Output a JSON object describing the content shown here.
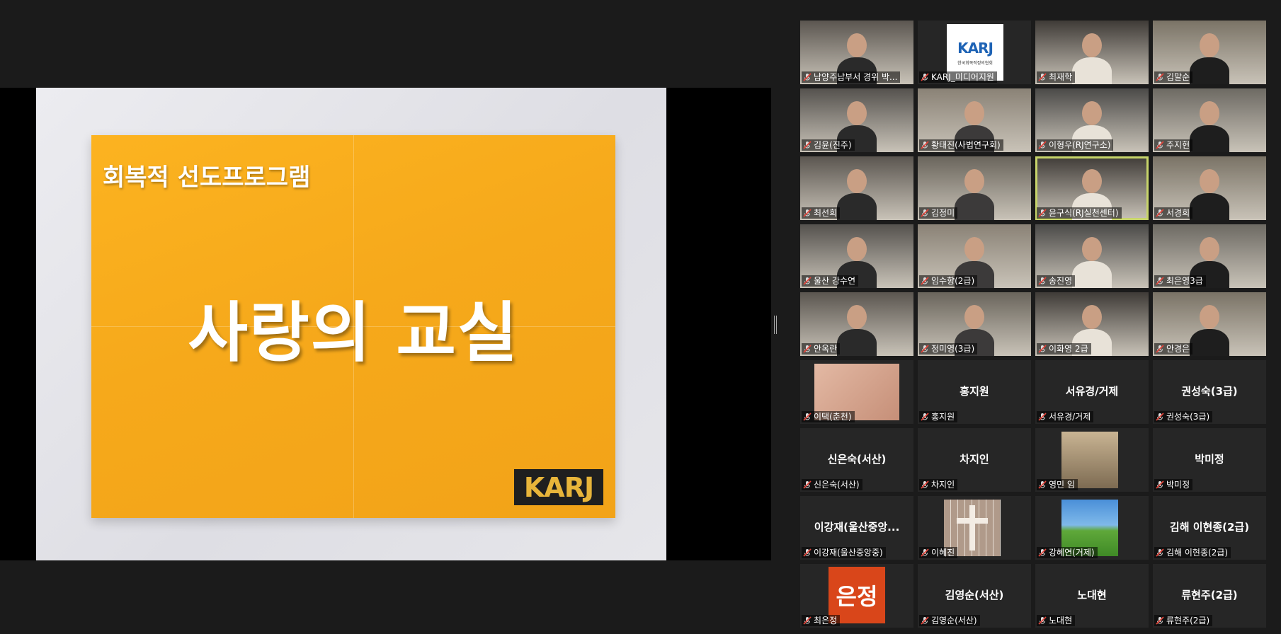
{
  "share": {
    "subtitle": "회복적 선도프로그램",
    "title": "사랑의 교실",
    "logo_text": "KARJ"
  },
  "colors": {
    "background": "#1b1b1b",
    "poster_orange": "#f6a91b",
    "active_speaker": "#c7d46a",
    "muted_mic": "#e0443a"
  },
  "participants": [
    {
      "label": "남양주남부서 경위 박...",
      "center_name": "",
      "video": true
    },
    {
      "label": "KARJ_미디어지원",
      "center_name": "",
      "video": true,
      "logo_text": "KARJ",
      "logo_caption": "한국회복적정의협회"
    },
    {
      "label": "최재학",
      "center_name": "",
      "video": true
    },
    {
      "label": "김말순",
      "center_name": "",
      "video": true
    },
    {
      "label": "김윤(진주)",
      "center_name": "",
      "video": true
    },
    {
      "label": "황태진(사법연구회)",
      "center_name": "",
      "video": true
    },
    {
      "label": "이형우(RJ연구소)",
      "center_name": "",
      "video": true
    },
    {
      "label": "주지헌",
      "center_name": "",
      "video": true
    },
    {
      "label": "최선희",
      "center_name": "",
      "video": true
    },
    {
      "label": "김정미",
      "center_name": "",
      "video": true
    },
    {
      "label": "윤구식(RJ실천센터)",
      "center_name": "",
      "video": true,
      "active": true
    },
    {
      "label": "서경희",
      "center_name": "",
      "video": true
    },
    {
      "label": "울산 강수연",
      "center_name": "",
      "video": true
    },
    {
      "label": "임수향(2급)",
      "center_name": "",
      "video": true
    },
    {
      "label": "송진영",
      "center_name": "",
      "video": true
    },
    {
      "label": "최은영3급",
      "center_name": "",
      "video": true
    },
    {
      "label": "안옥란",
      "center_name": "",
      "video": true
    },
    {
      "label": "정미영(3급)",
      "center_name": "",
      "video": true
    },
    {
      "label": "이화영 2급",
      "center_name": "",
      "video": true
    },
    {
      "label": "안경은",
      "center_name": "",
      "video": true
    },
    {
      "label": "이택(춘천)",
      "center_name": "",
      "video": false,
      "avatar": "photo"
    },
    {
      "label": "홍지원",
      "center_name": "홍지원",
      "video": false
    },
    {
      "label": "서유경/거제",
      "center_name": "서유경/거제",
      "video": false
    },
    {
      "label": "권성숙(3급)",
      "center_name": "권성숙(3급)",
      "video": false
    },
    {
      "label": "신은숙(서산)",
      "center_name": "신은숙(서산)",
      "video": false
    },
    {
      "label": "차지인",
      "center_name": "차지인",
      "video": false
    },
    {
      "label": "영민 임",
      "center_name": "",
      "video": false,
      "avatar": "painting"
    },
    {
      "label": "박미정",
      "center_name": "박미정",
      "video": false
    },
    {
      "label": "이강재(울산중앙중)",
      "center_name": "이강재(울산중앙...",
      "video": false
    },
    {
      "label": "이혜진",
      "center_name": "",
      "video": false,
      "avatar": "cross"
    },
    {
      "label": "강혜연(거제)",
      "center_name": "",
      "video": false,
      "avatar": "tree"
    },
    {
      "label": "김해 이현종(2급)",
      "center_name": "김해 이현종(2급)",
      "video": false
    },
    {
      "label": "최은정",
      "center_name": "",
      "video": false,
      "avatar": "text",
      "avatar_text": "은정"
    },
    {
      "label": "김영순(서산)",
      "center_name": "김영순(서산)",
      "video": false
    },
    {
      "label": "노대현",
      "center_name": "노대현",
      "video": false
    },
    {
      "label": "류현주(2급)",
      "center_name": "류현주(2급)",
      "video": false
    }
  ]
}
